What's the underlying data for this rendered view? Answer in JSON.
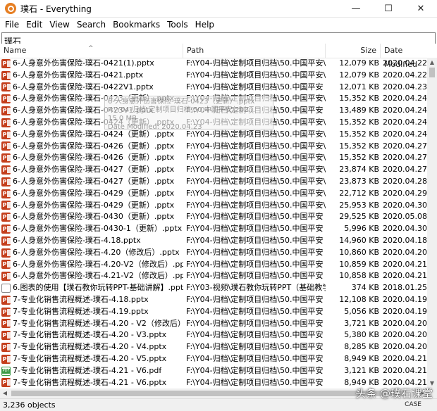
{
  "window": {
    "title": "璞石 - Everything",
    "icon": "everything-magnifier-icon",
    "minimize": "—",
    "maximize": "☐",
    "close": "✕"
  },
  "menu": [
    "File",
    "Edit",
    "View",
    "Search",
    "Bookmarks",
    "Tools",
    "Help"
  ],
  "search": {
    "value": "璞石"
  },
  "columns": {
    "name": "Name",
    "path": "Path",
    "size": "Size",
    "date": "Date Modified"
  },
  "rows": [
    {
      "icon": "ppt",
      "name": "6-人身意外伤害保险-璞石-0421(1).pptx",
      "path": "F:\\Y04-归档\\定制项目归档\\50.中国平安\\202...",
      "size": "12,079 KB",
      "date": "2020.04.22 17"
    },
    {
      "icon": "ppt",
      "name": "6-人身意外伤害保险-璞石-0421.pptx",
      "path": "F:\\Y04-归档\\定制项目归档\\50.中国平安\\202...",
      "size": "12,079 KB",
      "date": "2020.04.22 17"
    },
    {
      "icon": "ppt",
      "name": "6-人身意外伤害保险-璞石-0422V1.pptx",
      "path": "F:\\Y04-归档\\定制项目归档\\50.中国平安",
      "size": "12,071 KB",
      "date": "2020.04.23 08"
    },
    {
      "icon": "ppt",
      "name": "6-人身意外伤害保险-璞石-0423（更新）.pptx",
      "path": "F:\\Y04-归档\\定制项目归档\\50.中国平安\\202...",
      "size": "15,352 KB",
      "date": "2020.04.24 10"
    },
    {
      "icon": "ppt",
      "name": "6-人身意外伤害保险-璞石-0423V1.pptx",
      "path": "F:\\Y04-归档\\定制项目归档\\50.中国平安",
      "size": "13,489 KB",
      "date": "2020.04.24 18"
    },
    {
      "icon": "ppt",
      "name": "6-人身意外伤害保险-璞石-0424（更新）.pptx",
      "path": "F:\\Y04-归档\\定制项目归档\\50.中国平安\\202...",
      "size": "15,352 KB",
      "date": "2020.04.24 22"
    },
    {
      "icon": "ppt",
      "name": "6-人身意外伤害保险-璞石-0424（更新）.pptx",
      "path": "F:\\Y04-归档\\定制项目归档\\50.中国平安\\202...",
      "size": "15,352 KB",
      "date": "2020.04.24 22"
    },
    {
      "icon": "ppt",
      "name": "6-人身意外伤害保险-璞石-0426（更新）.pptx",
      "path": "F:\\Y04-归档\\定制项目归档\\50.中国平安\\202...",
      "size": "15,352 KB",
      "date": "2020.04.27 09"
    },
    {
      "icon": "ppt",
      "name": "6-人身意外伤害保险-璞石-0426（更新）.pptx",
      "path": "F:\\Y04-归档\\定制项目归档\\50.中国平安\\202...",
      "size": "15,352 KB",
      "date": "2020.04.27 09"
    },
    {
      "icon": "ppt",
      "name": "6-人身意外伤害保险-璞石-0427（更新）.pptx",
      "path": "F:\\Y04-归档\\定制项目归档\\50.中国平安\\202...",
      "size": "23,874 KB",
      "date": "2020.04.27 18"
    },
    {
      "icon": "ppt",
      "name": "6-人身意外伤害保险-璞石-0427（更新）.pptx",
      "path": "F:\\Y04-归档\\定制项目归档\\50.中国平安\\202...",
      "size": "23,873 KB",
      "date": "2020.04.28 18"
    },
    {
      "icon": "ppt",
      "name": "6-人身意外伤害保险-璞石-0429（更新）.pptx",
      "path": "F:\\Y04-归档\\定制项目归档\\50.中国平安\\202...",
      "size": "22,712 KB",
      "date": "2020.04.29 12"
    },
    {
      "icon": "ppt",
      "name": "6-人身意外伤害保险-璞石-0429（更新）.pptx",
      "path": "F:\\Y04-归档\\定制项目归档\\50.中国平安\\202...",
      "size": "25,953 KB",
      "date": "2020.04.30 06"
    },
    {
      "icon": "ppt",
      "name": "6-人身意外伤害保险-璞石-0430（更新）.pptx",
      "path": "F:\\Y04-归档\\定制项目归档\\50.中国平安",
      "size": "29,525 KB",
      "date": "2020.05.08 10"
    },
    {
      "icon": "ppt",
      "name": "6-人身意外伤害保险-璞石-0430-1（更新）.pptx",
      "path": "F:\\Y04-归档\\定制项目归档\\50.中国平安",
      "size": "5,996 KB",
      "date": "2020.04.30 18"
    },
    {
      "icon": "ppt",
      "name": "6-人身意外伤害保险-璞石-4.18.pptx",
      "path": "F:\\Y04-归档\\定制项目归档\\50.中国平安",
      "size": "14,960 KB",
      "date": "2020.04.18 22"
    },
    {
      "icon": "ppt",
      "name": "6-人身意外伤害保险-璞石-4.20（修改后）.pptx",
      "path": "F:\\Y04-归档\\定制项目归档\\50.中国平安",
      "size": "10,860 KB",
      "date": "2020.04.20 08"
    },
    {
      "icon": "ppt",
      "name": "6-人身意外伤害保险-璞石-4.20-V2（修改后）.pptx",
      "path": "F:\\Y04-归档\\定制项目归档\\50.中国平安",
      "size": "10,859 KB",
      "date": "2020.04.21 10"
    },
    {
      "icon": "ppt",
      "name": "6-人身意外伤害保险-璞石-4.21-V2（修改后）.pptx",
      "path": "F:\\Y04-归档\\定制项目归档\\50.中国平安",
      "size": "10,858 KB",
      "date": "2020.04.21 15"
    },
    {
      "icon": "doc",
      "name": "6.图表的使用【璞石教你玩转PPT-基础讲解】.pptx",
      "path": "F:\\Y03-视频\\璞石教你玩转PPT（基础教学）",
      "size": "374 KB",
      "date": "2018.01.25 21"
    },
    {
      "icon": "ppt",
      "name": "7-专业化销售流程概述-璞石-4.18.pptx",
      "path": "F:\\Y04-归档\\定制项目归档\\50.中国平安",
      "size": "12,108 KB",
      "date": "2020.04.19 15"
    },
    {
      "icon": "ppt",
      "name": "7-专业化销售流程概述-璞石-4.19.pptx",
      "path": "F:\\Y04-归档\\定制项目归档\\50.中国平安",
      "size": "5,056 KB",
      "date": "2020.04.19 15"
    },
    {
      "icon": "ppt",
      "name": "7-专业化销售流程概述-璞石-4.20 - V2（修改后）.pptx",
      "path": "F:\\Y04-归档\\定制项目归档\\50.中国平安",
      "size": "3,721 KB",
      "date": "2020.04.20 08"
    },
    {
      "icon": "ppt",
      "name": "7-专业化销售流程概述-璞石-4.20 - V3.pptx",
      "path": "F:\\Y04-归档\\定制项目归档\\50.中国平安",
      "size": "5,380 KB",
      "date": "2020.04.20 23"
    },
    {
      "icon": "ppt",
      "name": "7-专业化销售流程概述-璞石-4.20 - V4.pptx",
      "path": "F:\\Y04-归档\\定制项目归档\\50.中国平安",
      "size": "8,285 KB",
      "date": "2020.04.20 23"
    },
    {
      "icon": "ppt",
      "name": "7-专业化销售流程概述-璞石-4.20 - V5.pptx",
      "path": "F:\\Y04-归档\\定制项目归档\\50.中国平安",
      "size": "8,949 KB",
      "date": "2020.04.21 10"
    },
    {
      "icon": "pdf",
      "name": "7-专业化销售流程概述-璞石-4.21 - V6.pdf",
      "path": "F:\\Y04-归档\\定制项目归档\\50.中国平安",
      "size": "3,121 KB",
      "date": "2020.04.21 15"
    },
    {
      "icon": "ppt",
      "name": "7-专业化销售流程概述-璞石-4.21 - V6.pptx",
      "path": "F:\\Y04-归档\\定制项目归档\\50.中国平安",
      "size": "8,949 KB",
      "date": "2020.04.21 15"
    }
  ],
  "tooltip": {
    "line1": "6-人身意外伤害保险-璞石-0423（更新）.pptx",
    "line2": "F:\\Y04-归档\\定制项目归档\\50.中国平安\\202...",
    "line3": "15.0 MB",
    "line4": "Date Modified: 2020.04.23"
  },
  "status": {
    "count": "3,236 objects",
    "case": "CASE"
  },
  "watermark": "头条 @璞石课堂"
}
